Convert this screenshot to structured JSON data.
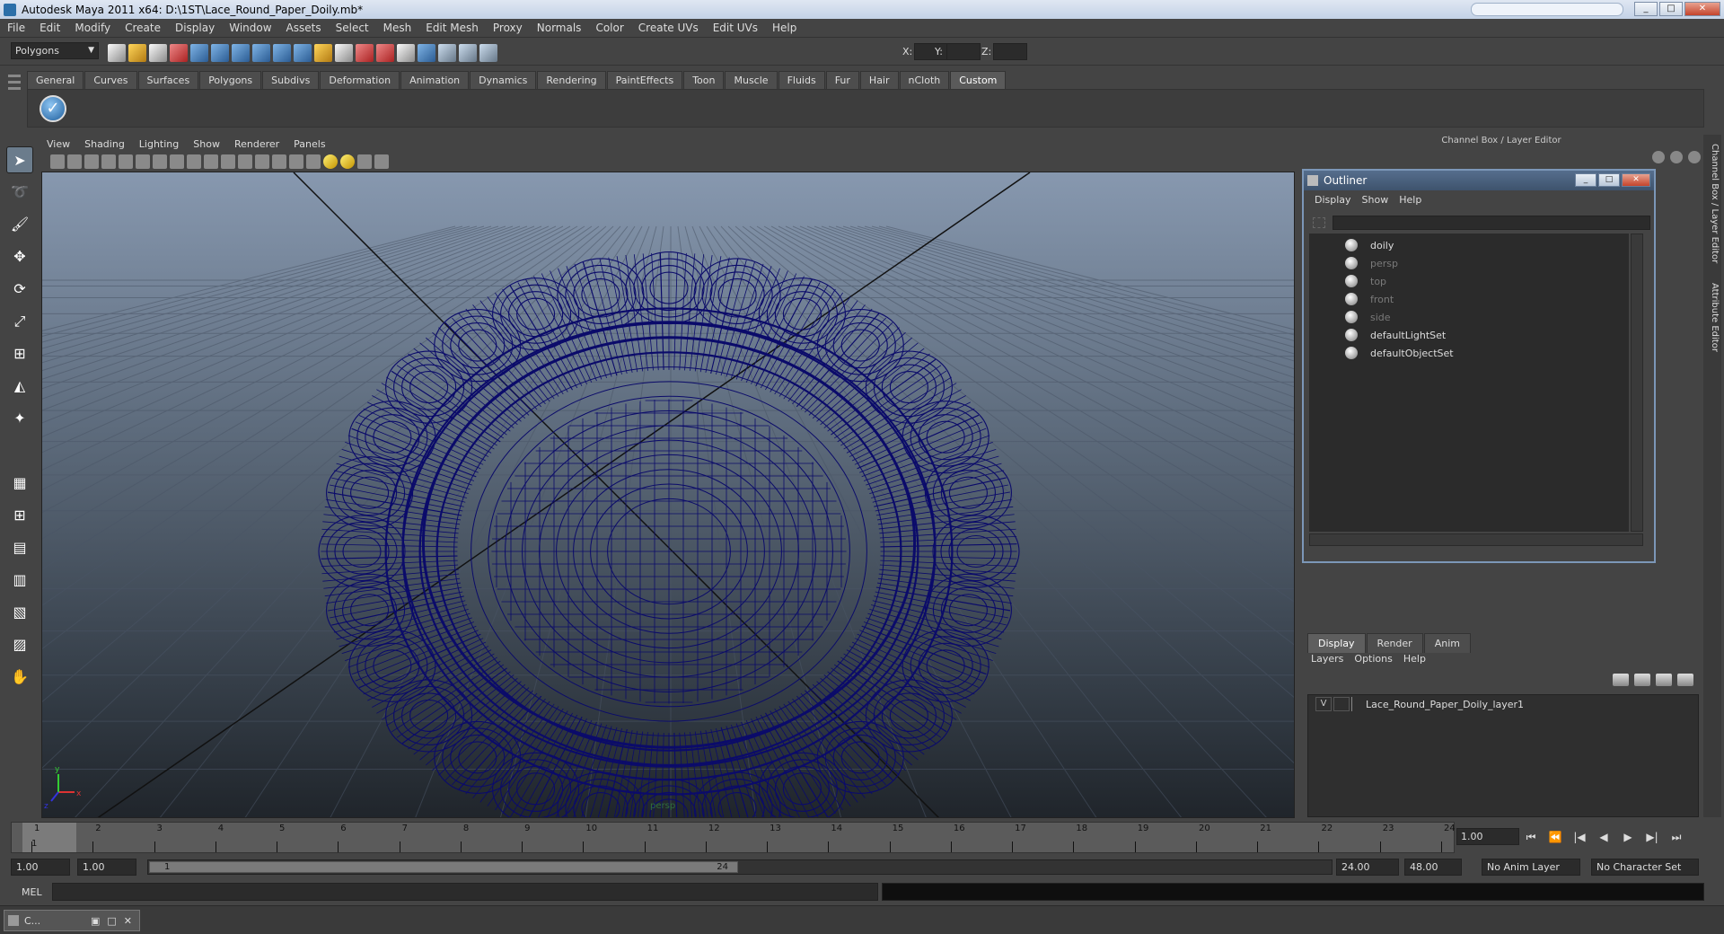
{
  "window": {
    "title": "Autodesk Maya 2011 x64: D:\\1ST\\Lace_Round_Paper_Doily.mb*"
  },
  "menubar": [
    "File",
    "Edit",
    "Modify",
    "Create",
    "Display",
    "Window",
    "Assets",
    "Select",
    "Mesh",
    "Edit Mesh",
    "Proxy",
    "Normals",
    "Color",
    "Create UVs",
    "Edit UVs",
    "Help"
  ],
  "statusline": {
    "mode": "Polygons",
    "x_label": "X:",
    "y_label": "Y:",
    "z_label": "Z:"
  },
  "shelf": {
    "tabs": [
      "General",
      "Curves",
      "Surfaces",
      "Polygons",
      "Subdivs",
      "Deformation",
      "Animation",
      "Dynamics",
      "Rendering",
      "PaintEffects",
      "Toon",
      "Muscle",
      "Fluids",
      "Fur",
      "Hair",
      "nCloth",
      "Custom"
    ],
    "active_tab": "Custom"
  },
  "viewport": {
    "menu": [
      "View",
      "Shading",
      "Lighting",
      "Show",
      "Renderer",
      "Panels"
    ],
    "camera_label": "persp",
    "axis_labels": {
      "x": "x",
      "y": "y",
      "z": "z"
    }
  },
  "right_panel": {
    "header": "Channel Box / Layer Editor",
    "side_tabs": [
      "Channel Box / Layer Editor",
      "Attribute Editor"
    ]
  },
  "outliner": {
    "title": "Outliner",
    "menu": [
      "Display",
      "Show",
      "Help"
    ],
    "items": [
      {
        "label": "doily",
        "dim": false
      },
      {
        "label": "persp",
        "dim": true
      },
      {
        "label": "top",
        "dim": true
      },
      {
        "label": "front",
        "dim": true
      },
      {
        "label": "side",
        "dim": true
      },
      {
        "label": "defaultLightSet",
        "dim": false
      },
      {
        "label": "defaultObjectSet",
        "dim": false
      }
    ]
  },
  "layer_editor": {
    "tabs": [
      "Display",
      "Render",
      "Anim"
    ],
    "active_tab": "Display",
    "menu": [
      "Layers",
      "Options",
      "Help"
    ],
    "layers": [
      {
        "visible": "V",
        "name": "Lace_Round_Paper_Doily_layer1"
      }
    ]
  },
  "timeline": {
    "ticks": [
      "1",
      "2",
      "3",
      "4",
      "5",
      "6",
      "7",
      "8",
      "9",
      "10",
      "11",
      "12",
      "13",
      "14",
      "15",
      "16",
      "17",
      "18",
      "19",
      "20",
      "21",
      "22",
      "23",
      "24"
    ],
    "current_frame_marker": "1",
    "current_frame": "1.00"
  },
  "range": {
    "start": "1.00",
    "playback_start": "1.00",
    "handle_start": "1",
    "handle_end": "24",
    "playback_end": "24.00",
    "end": "48.00",
    "anim_layer": "No Anim Layer",
    "character_set": "No Character Set"
  },
  "cmdline": {
    "label": "MEL"
  },
  "taskbar": {
    "minimized_window": "C..."
  },
  "colors": {
    "wireframe": "#0b0b6a",
    "grid": "#4a5566",
    "accent": "#5f7b9c"
  }
}
